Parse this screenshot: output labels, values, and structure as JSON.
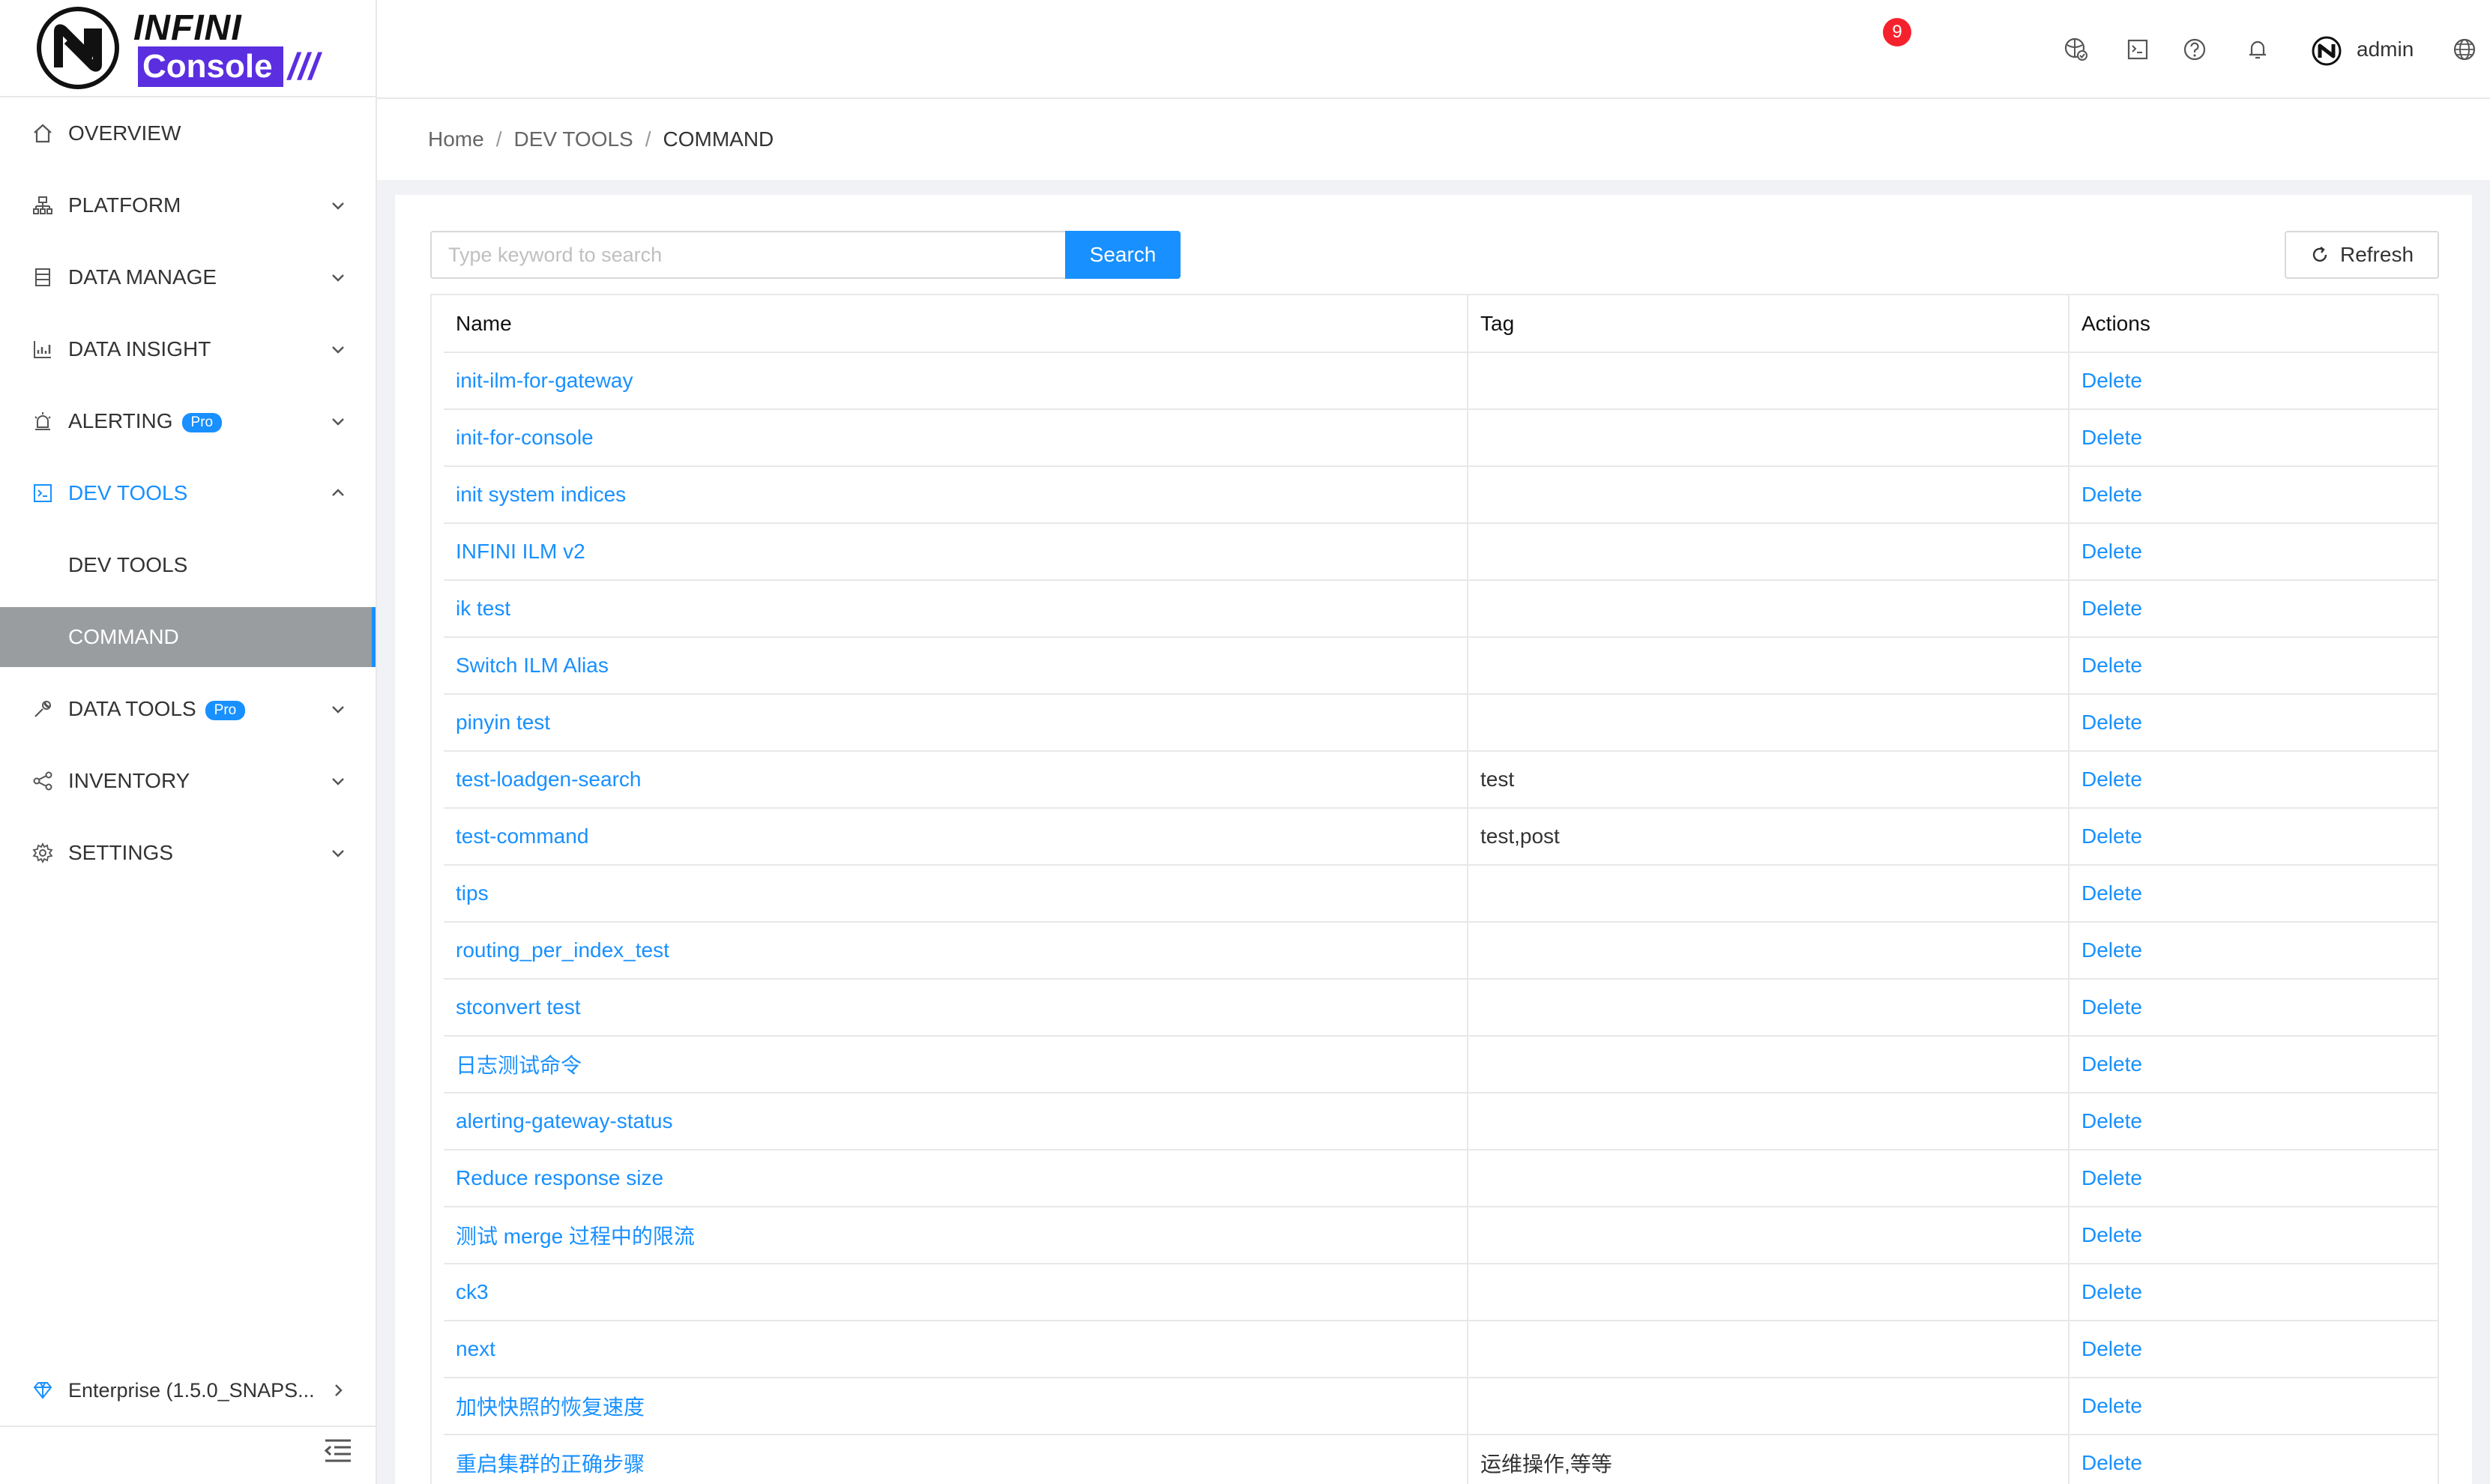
{
  "brand": {
    "line1": "INFINI",
    "line2": "Console",
    "slashes": "///"
  },
  "header": {
    "notification_count": "9",
    "username": "admin",
    "icons": [
      "shield-check-icon",
      "terminal-icon",
      "help-icon",
      "bell-icon",
      "globe-icon"
    ]
  },
  "sidebar": {
    "items": [
      {
        "label": "OVERVIEW",
        "icon": "home-icon"
      },
      {
        "label": "PLATFORM",
        "icon": "cluster-icon"
      },
      {
        "label": "DATA MANAGE",
        "icon": "database-icon"
      },
      {
        "label": "DATA INSIGHT",
        "icon": "chart-icon"
      },
      {
        "label": "ALERTING",
        "icon": "alarm-icon",
        "badge": "Pro"
      },
      {
        "label": "DEV TOOLS",
        "icon": "code-icon"
      },
      {
        "label": "DATA TOOLS",
        "icon": "wrench-icon",
        "badge": "Pro"
      },
      {
        "label": "INVENTORY",
        "icon": "share-icon"
      },
      {
        "label": "SETTINGS",
        "icon": "gear-icon"
      }
    ],
    "dev_tools_sub": [
      "DEV TOOLS",
      "COMMAND"
    ],
    "enterprise": "Enterprise (1.5.0_SNAPS..."
  },
  "breadcrumb": {
    "home": "Home",
    "section": "DEV TOOLS",
    "current": "COMMAND"
  },
  "toolbar": {
    "search_placeholder": "Type keyword to search",
    "search_label": "Search",
    "refresh_label": "Refresh"
  },
  "table": {
    "headers": {
      "name": "Name",
      "tag": "Tag",
      "actions": "Actions"
    },
    "action_label": "Delete",
    "rows": [
      {
        "name": "init-ilm-for-gateway",
        "tag": ""
      },
      {
        "name": "init-for-console",
        "tag": ""
      },
      {
        "name": "init system indices",
        "tag": ""
      },
      {
        "name": "INFINI ILM v2",
        "tag": ""
      },
      {
        "name": "ik test",
        "tag": ""
      },
      {
        "name": "Switch ILM Alias",
        "tag": ""
      },
      {
        "name": "pinyin test",
        "tag": ""
      },
      {
        "name": "test-loadgen-search",
        "tag": "test"
      },
      {
        "name": "test-command",
        "tag": "test,post"
      },
      {
        "name": "tips",
        "tag": ""
      },
      {
        "name": "routing_per_index_test",
        "tag": ""
      },
      {
        "name": "stconvert test",
        "tag": ""
      },
      {
        "name": "日志测试命令",
        "tag": ""
      },
      {
        "name": "alerting-gateway-status",
        "tag": ""
      },
      {
        "name": "Reduce response size",
        "tag": ""
      },
      {
        "name": "测试 merge 过程中的限流",
        "tag": ""
      },
      {
        "name": "ck3",
        "tag": ""
      },
      {
        "name": "next",
        "tag": ""
      },
      {
        "name": "加快快照的恢复速度",
        "tag": ""
      },
      {
        "name": "重启集群的正确步骤",
        "tag": "运维操作,等等"
      }
    ]
  },
  "colors": {
    "accent": "#1890ff",
    "brand_purple": "#5b2ee0",
    "badge_red": "#f5222d",
    "selected_bg": "#9a9d9f"
  }
}
